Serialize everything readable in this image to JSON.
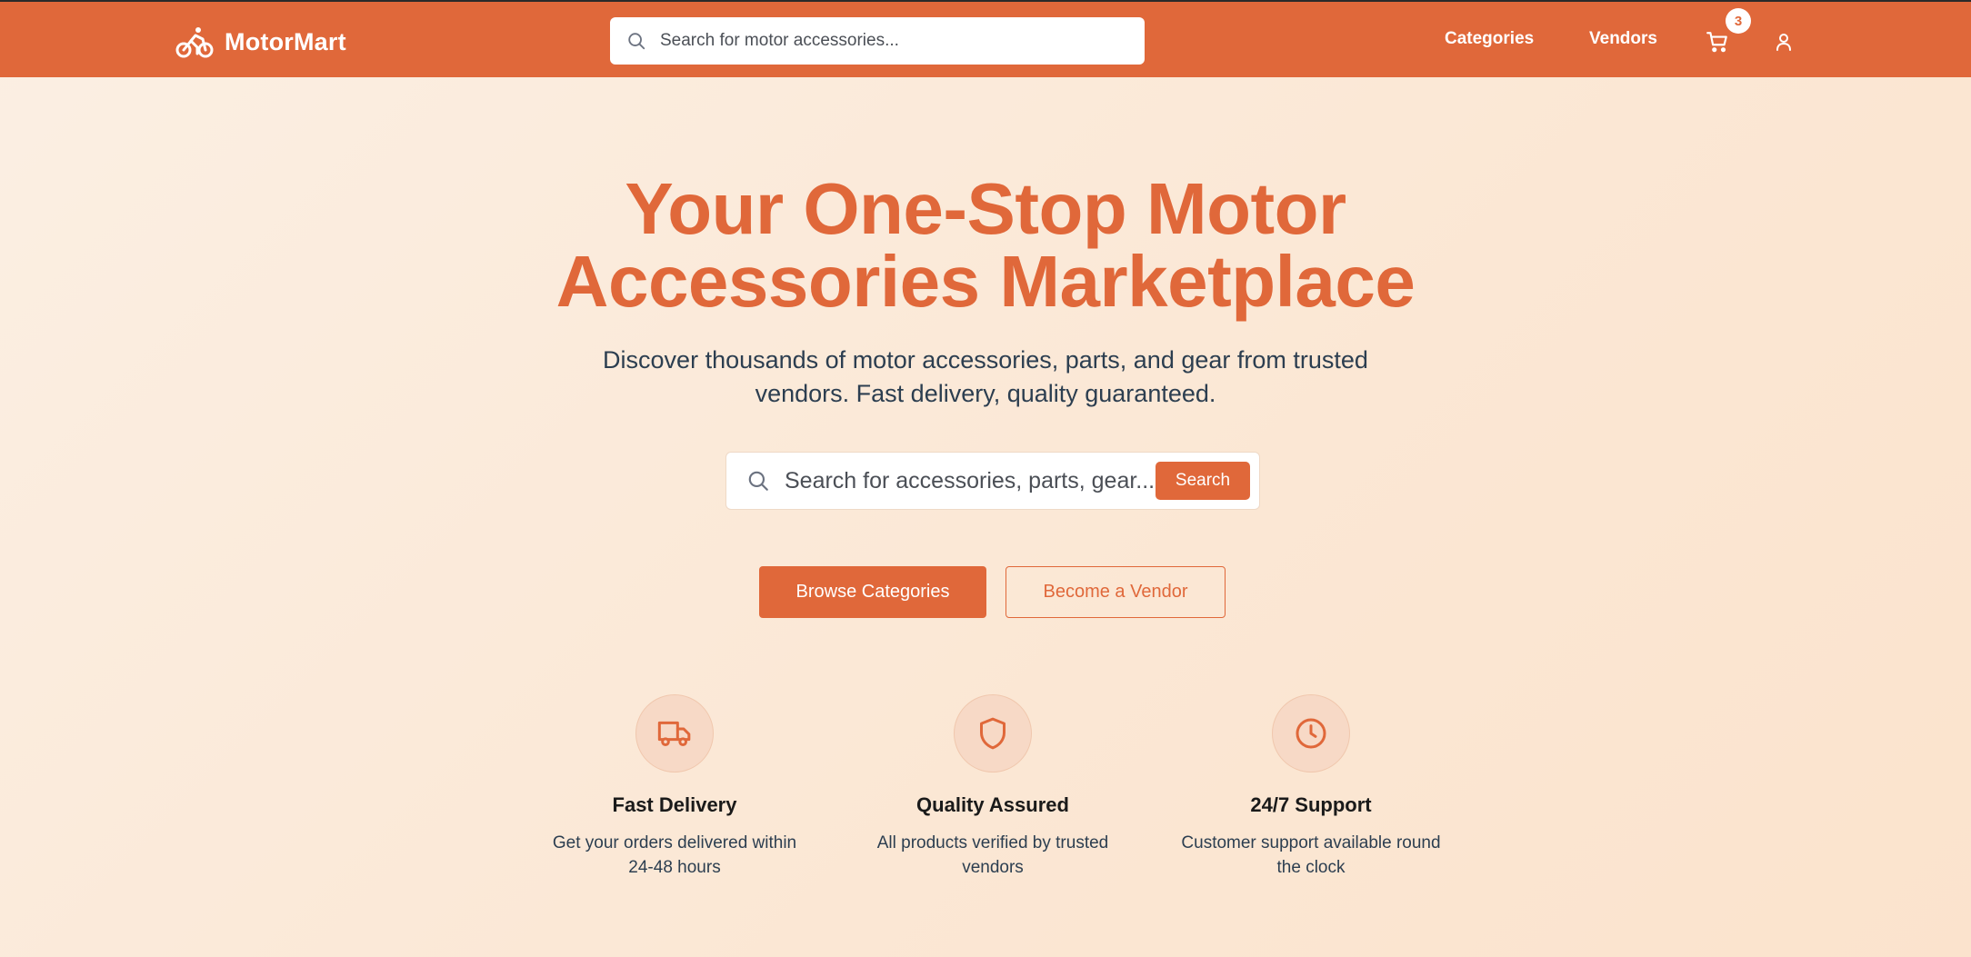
{
  "header": {
    "brand": "MotorMart",
    "search_placeholder": "Search for motor accessories...",
    "nav": [
      {
        "label": "Categories"
      },
      {
        "label": "Vendors"
      }
    ],
    "cart_count": "3",
    "icons": [
      "bike-icon",
      "search-icon",
      "cart-icon",
      "user-icon"
    ]
  },
  "hero": {
    "title_line1": "Your One-Stop Motor",
    "title_line2": "Accessories Marketplace",
    "subtitle_line1": "Discover thousands of motor accessories, parts, and gear from trusted",
    "subtitle_line2": "vendors. Fast delivery, quality guaranteed.",
    "search_placeholder": "Search for accessories, parts, gear...",
    "search_button": "Search",
    "primary_cta": "Browse Categories",
    "secondary_cta": "Become a Vendor"
  },
  "features": [
    {
      "icon": "truck-icon",
      "title": "Fast Delivery",
      "desc_line1": "Get your orders delivered within",
      "desc_line2": "24-48 hours"
    },
    {
      "icon": "shield-icon",
      "title": "Quality Assured",
      "desc_line1": "All products verified by trusted",
      "desc_line2": "vendors"
    },
    {
      "icon": "clock-icon",
      "title": "24/7 Support",
      "desc_line1": "Customer support available round",
      "desc_line2": "the clock"
    }
  ],
  "colors": {
    "brand": "#e0683a",
    "header_bg": "#e0683a",
    "page_bg": "#fbefe3",
    "text_dark": "#2c3e50",
    "icon_circle": "#f7d9c6"
  }
}
